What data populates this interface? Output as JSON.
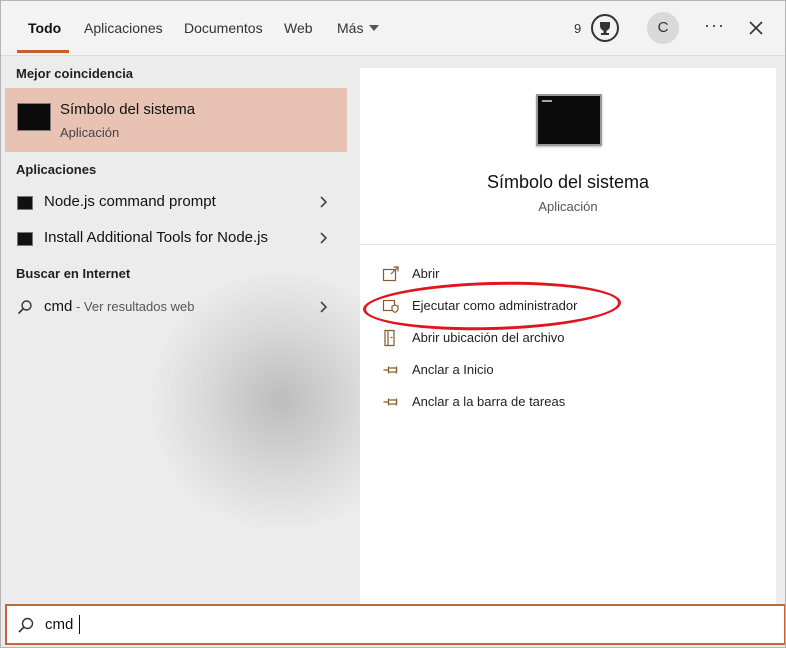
{
  "tabs": [
    {
      "label": "Todo"
    },
    {
      "label": "Aplicaciones"
    },
    {
      "label": "Documentos"
    },
    {
      "label": "Web"
    },
    {
      "label": "Más"
    }
  ],
  "header": {
    "points": "9",
    "avatar_initial": "C",
    "more_label": "···"
  },
  "left": {
    "best_match_heading": "Mejor coincidencia",
    "best_match": {
      "title": "Símbolo del sistema",
      "subtitle": "Aplicación"
    },
    "apps_heading": "Aplicaciones",
    "apps": [
      {
        "label": "Node.js command prompt"
      },
      {
        "label": "Install Additional Tools for Node.js"
      }
    ],
    "web_heading": "Buscar en Internet",
    "web": {
      "query": "cmd",
      "hint": " - Ver resultados web"
    }
  },
  "detail": {
    "title": "Símbolo del sistema",
    "subtitle": "Aplicación",
    "actions": [
      {
        "label": "Abrir",
        "icon": "open-icon"
      },
      {
        "label": "Ejecutar como administrador",
        "icon": "shield-icon"
      },
      {
        "label": "Abrir ubicación del archivo",
        "icon": "file-location-icon"
      },
      {
        "label": "Anclar a Inicio",
        "icon": "pin-icon"
      },
      {
        "label": "Anclar a la barra de tareas",
        "icon": "pin-icon"
      }
    ]
  },
  "search": {
    "value": "cmd"
  },
  "colors": {
    "accent": "#c85d2e",
    "highlight": "#e8c3b3",
    "annotation": "#e0151f"
  }
}
